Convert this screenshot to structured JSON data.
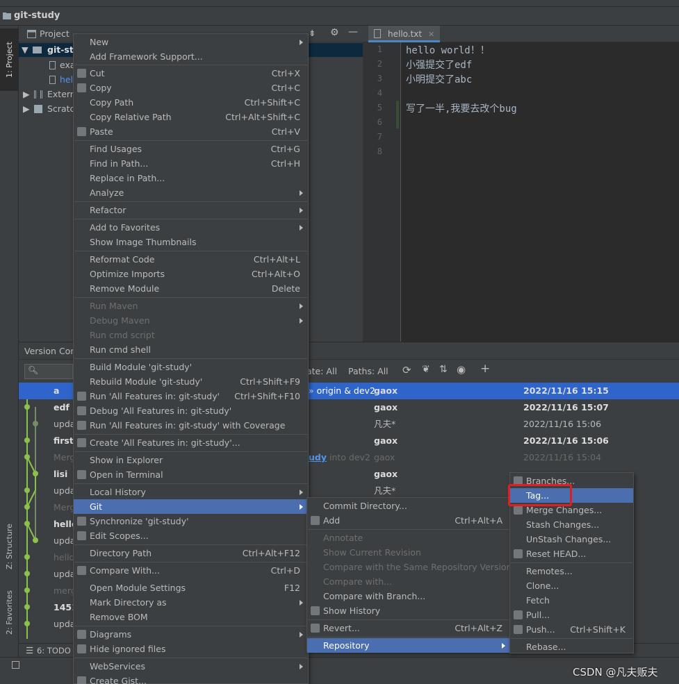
{
  "navbar": {
    "project_name": "git-study"
  },
  "left_strip": {
    "tab_project": "1: Project",
    "tab_structure": "Z: Structure",
    "tab_favorites": "2: Favorites"
  },
  "project_panel": {
    "title": "Project",
    "tree": [
      "git-stu",
      "exa",
      "hel",
      "Extern",
      "Scratc"
    ]
  },
  "editor": {
    "tab_name": "hello.txt",
    "line_numbers": [
      "1",
      "2",
      "3",
      "4",
      "5",
      "6",
      "7",
      "8"
    ],
    "lines": [
      "hello world！！",
      "小强提交了edf",
      "小明提交了abc",
      "",
      "写了一半,我要去改个bug",
      "",
      "",
      ""
    ]
  },
  "vc_panel": {
    "title": "Version Cor",
    "filter_date": "ate: All",
    "filter_paths": "Paths: All",
    "ref_label": "origin & dev2",
    "merge_link_text": "udy",
    "merge_rest_text": "into dev2",
    "rows": [
      {
        "subject": "a",
        "author": "gaox",
        "date": "2022/11/16 15:15",
        "style": "sel"
      },
      {
        "subject": "edf",
        "author": "gaox",
        "date": "2022/11/16 15:07",
        "style": "bold"
      },
      {
        "subject": "upda",
        "author": "凡夫*",
        "date": "2022/11/16 15:06",
        "style": "normal"
      },
      {
        "subject": "first",
        "author": "gaox",
        "date": "2022/11/16 15:06",
        "style": "bold"
      },
      {
        "subject": "Merg",
        "author": "gaox",
        "date": "2022/11/16 15:04",
        "style": "dim"
      },
      {
        "subject": "lisi",
        "author": "gaox",
        "date": "",
        "style": "bold"
      },
      {
        "subject": "upda",
        "author": "凡夫*",
        "date": "",
        "style": "normal"
      },
      {
        "subject": "Merg",
        "author": "",
        "date": "",
        "style": "dim"
      },
      {
        "subject": "hello",
        "author": "",
        "date": "",
        "style": "bold"
      },
      {
        "subject": "upda",
        "author": "",
        "date": "",
        "style": "normal"
      },
      {
        "subject": "hello",
        "author": "",
        "date": "",
        "style": "dim"
      },
      {
        "subject": "upda",
        "author": "",
        "date": "",
        "style": "normal"
      },
      {
        "subject": "merg",
        "author": "",
        "date": "",
        "style": "dim"
      },
      {
        "subject": "1451",
        "author": "",
        "date": "",
        "style": "bold"
      },
      {
        "subject": "upda",
        "author": "",
        "date": "",
        "style": "normal"
      }
    ]
  },
  "bottom_bar": {
    "todo": "6: TODO"
  },
  "context_menu": {
    "items": [
      {
        "label": "New",
        "shortcut": "",
        "submenu": true
      },
      {
        "label": "Add Framework Support...",
        "shortcut": ""
      },
      {
        "label": "Cut",
        "shortcut": "Ctrl+X",
        "icon": "scissors-icon"
      },
      {
        "label": "Copy",
        "shortcut": "Ctrl+C",
        "icon": "copy-icon"
      },
      {
        "label": "Copy Path",
        "shortcut": "Ctrl+Shift+C"
      },
      {
        "label": "Copy Relative Path",
        "shortcut": "Ctrl+Alt+Shift+C"
      },
      {
        "label": "Paste",
        "shortcut": "Ctrl+V",
        "icon": "paste-icon"
      },
      {
        "label": "Find Usages",
        "shortcut": "Ctrl+G"
      },
      {
        "label": "Find in Path...",
        "shortcut": "Ctrl+H"
      },
      {
        "label": "Replace in Path...",
        "shortcut": ""
      },
      {
        "label": "Analyze",
        "shortcut": "",
        "submenu": true
      },
      {
        "label": "Refactor",
        "shortcut": "",
        "submenu": true
      },
      {
        "label": "Add to Favorites",
        "shortcut": "",
        "submenu": true
      },
      {
        "label": "Show Image Thumbnails",
        "shortcut": ""
      },
      {
        "label": "Reformat Code",
        "shortcut": "Ctrl+Alt+L"
      },
      {
        "label": "Optimize Imports",
        "shortcut": "Ctrl+Alt+O"
      },
      {
        "label": "Remove Module",
        "shortcut": "Delete"
      },
      {
        "label": "Run Maven",
        "shortcut": "",
        "submenu": true,
        "disabled": true
      },
      {
        "label": "Debug Maven",
        "shortcut": "",
        "submenu": true,
        "disabled": true
      },
      {
        "label": "Run cmd script",
        "shortcut": "",
        "disabled": true
      },
      {
        "label": "Run cmd shell",
        "shortcut": ""
      },
      {
        "label": "Build Module 'git-study'",
        "shortcut": ""
      },
      {
        "label": "Rebuild Module 'git-study'",
        "shortcut": "Ctrl+Shift+F9"
      },
      {
        "label": "Run 'All Features in: git-study'",
        "shortcut": "Ctrl+Shift+F10",
        "icon": "run-icon"
      },
      {
        "label": "Debug 'All Features in: git-study'",
        "shortcut": "",
        "icon": "debug-icon"
      },
      {
        "label": "Run 'All Features in: git-study' with Coverage",
        "shortcut": "",
        "icon": "coverage-icon"
      },
      {
        "label": "Create 'All Features in: git-study'...",
        "shortcut": "",
        "icon": "create-config-icon"
      },
      {
        "label": "Show in Explorer",
        "shortcut": ""
      },
      {
        "label": "Open in Terminal",
        "shortcut": "",
        "icon": "terminal-icon"
      },
      {
        "label": "Local History",
        "shortcut": "",
        "submenu": true
      },
      {
        "label": "Git",
        "shortcut": "",
        "submenu": true,
        "highlighted": true
      },
      {
        "label": "Synchronize 'git-study'",
        "shortcut": "",
        "icon": "sync-icon"
      },
      {
        "label": "Edit Scopes...",
        "shortcut": "",
        "icon": "scope-icon"
      },
      {
        "label": "Directory Path",
        "shortcut": "Ctrl+Alt+F12"
      },
      {
        "label": "Compare With...",
        "shortcut": "Ctrl+D",
        "icon": "compare-icon"
      },
      {
        "label": "Open Module Settings",
        "shortcut": "F12"
      },
      {
        "label": "Mark Directory as",
        "shortcut": "",
        "submenu": true
      },
      {
        "label": "Remove BOM",
        "shortcut": ""
      },
      {
        "label": "Diagrams",
        "shortcut": "",
        "submenu": true,
        "icon": "diagram-icon"
      },
      {
        "label": "Hide ignored files",
        "shortcut": "",
        "icon": "ignore-icon"
      },
      {
        "label": "WebServices",
        "shortcut": "",
        "submenu": true
      },
      {
        "label": "Create Gist...",
        "shortcut": "",
        "icon": "github-icon"
      }
    ]
  },
  "git_menu": {
    "items": [
      {
        "label": "Commit Directory...",
        "shortcut": ""
      },
      {
        "label": "Add",
        "shortcut": "Ctrl+Alt+A",
        "icon": "plus-icon"
      },
      {
        "label": "Annotate",
        "shortcut": "",
        "disabled": true
      },
      {
        "label": "Show Current Revision",
        "shortcut": "",
        "disabled": true
      },
      {
        "label": "Compare with the Same Repository Version",
        "shortcut": "",
        "disabled": true
      },
      {
        "label": "Compare with...",
        "shortcut": "",
        "disabled": true
      },
      {
        "label": "Compare with Branch...",
        "shortcut": ""
      },
      {
        "label": "Show History",
        "shortcut": "",
        "icon": "history-icon"
      },
      {
        "label": "Revert...",
        "shortcut": "Ctrl+Alt+Z",
        "icon": "revert-icon"
      },
      {
        "label": "Repository",
        "shortcut": "",
        "submenu": true,
        "highlighted": true
      }
    ]
  },
  "repo_menu": {
    "items": [
      {
        "label": "Branches...",
        "shortcut": "",
        "icon": "branch-icon"
      },
      {
        "label": "Tag...",
        "shortcut": "",
        "highlighted": true
      },
      {
        "label": "Merge Changes...",
        "shortcut": "",
        "icon": "merge-icon"
      },
      {
        "label": "Stash Changes...",
        "shortcut": ""
      },
      {
        "label": "UnStash Changes...",
        "shortcut": ""
      },
      {
        "label": "Reset HEAD...",
        "shortcut": "",
        "icon": "reset-icon"
      },
      {
        "label": "Remotes...",
        "shortcut": ""
      },
      {
        "label": "Clone...",
        "shortcut": ""
      },
      {
        "label": "Fetch",
        "shortcut": ""
      },
      {
        "label": "Pull...",
        "shortcut": "",
        "icon": "pull-icon"
      },
      {
        "label": "Push...",
        "shortcut": "Ctrl+Shift+K",
        "icon": "push-icon"
      },
      {
        "label": "Rebase...",
        "shortcut": ""
      }
    ]
  },
  "watermark": "CSDN @凡夫贩夫",
  "colors": {
    "highlight": "#4b6eaf",
    "selection": "#2f65ca",
    "red_box": "#e02020"
  }
}
